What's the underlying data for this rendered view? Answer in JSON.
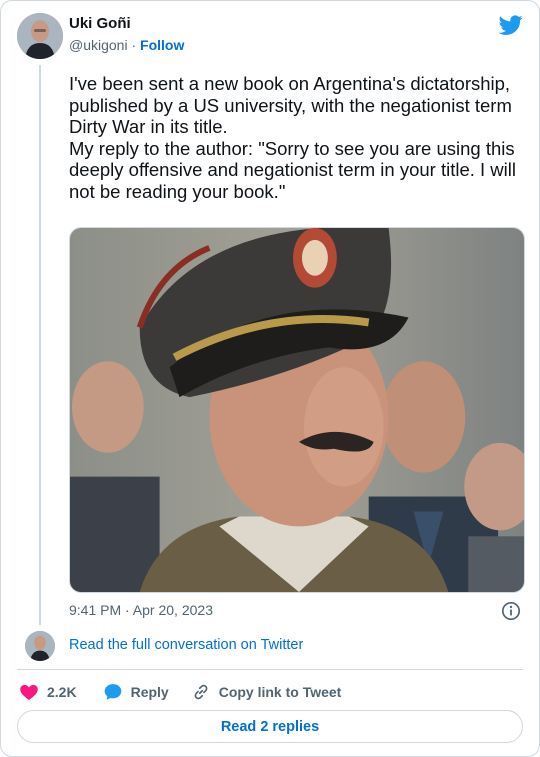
{
  "author": {
    "name": "Uki Goñi",
    "handle": "@ukigoni",
    "separator": " · ",
    "follow_label": "Follow"
  },
  "tweet": {
    "paragraphs": [
      "I've been sent a new book on Argentina's dictatorship, published by a US university, with the negationist term Dirty War in its title.",
      "My reply to the author: \"Sorry to see you are using this deeply offensive and negationist term in your title. I will not be reading your book.\""
    ],
    "timestamp": "9:41 PM · Apr 20, 2023"
  },
  "conversation": {
    "link_label": "Read the full conversation on Twitter"
  },
  "actions": {
    "likes": "2.2K",
    "reply_label": "Reply",
    "copy_label": "Copy link to Tweet"
  },
  "replies_button": "Read 2 replies",
  "icons": {
    "brand": "twitter-bird-icon",
    "info": "info-icon",
    "like": "heart-icon",
    "reply": "speech-bubble-icon",
    "copy": "link-icon"
  },
  "colors": {
    "link": "#006fd6",
    "twitter_blue": "#1d9bf0",
    "heart": "#f91880",
    "muted_text": "#536471",
    "border": "#cfd9de"
  }
}
